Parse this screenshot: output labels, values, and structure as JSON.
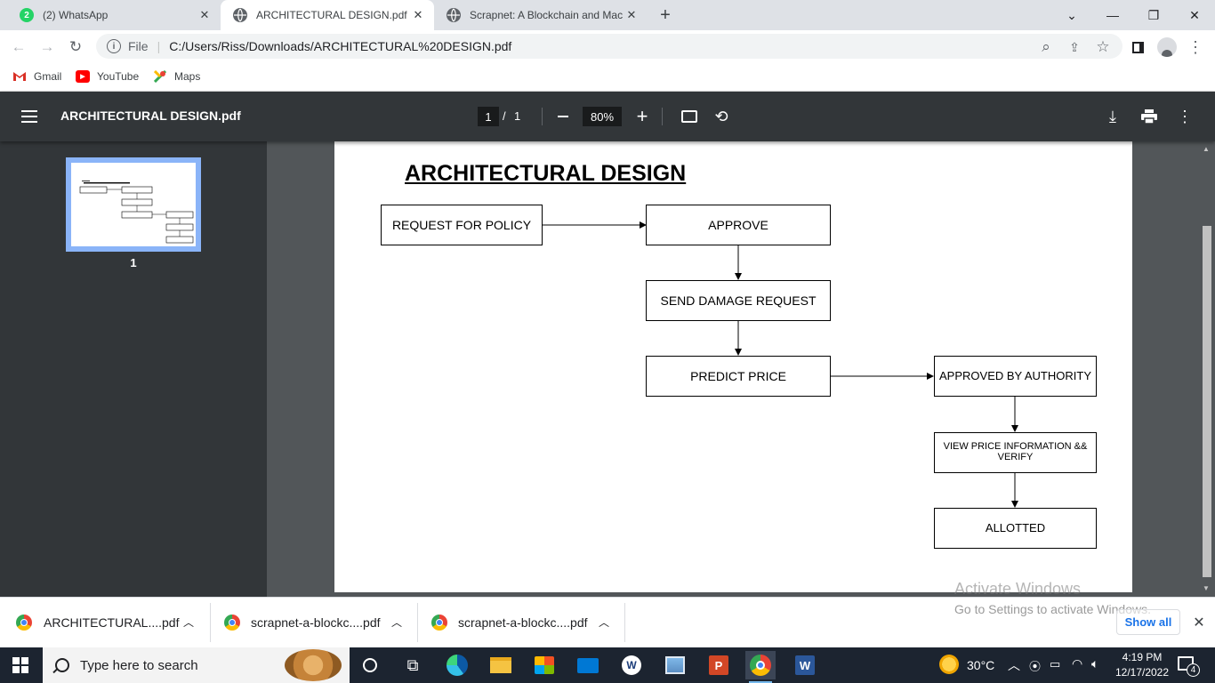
{
  "browser": {
    "tabs": [
      {
        "title": "(2) WhatsApp",
        "badge": "2",
        "active": false
      },
      {
        "title": "ARCHITECTURAL DESIGN.pdf",
        "active": true
      },
      {
        "title": "Scrapnet: A Blockchain and Mach",
        "active": false
      }
    ],
    "new_tab_icon": "plus-icon",
    "address": {
      "scheme_label": "File",
      "url": "C:/Users/Riss/Downloads/ARCHITECTURAL%20DESIGN.pdf"
    },
    "bookmarks": [
      {
        "label": "Gmail",
        "icon": "gmail-icon"
      },
      {
        "label": "YouTube",
        "icon": "youtube-icon"
      },
      {
        "label": "Maps",
        "icon": "maps-icon"
      }
    ]
  },
  "pdf_viewer": {
    "title": "ARCHITECTURAL DESIGN.pdf",
    "page_current": "1",
    "page_sep": "/",
    "page_total": "1",
    "zoom": "80%",
    "thumbnail_label": "1"
  },
  "document": {
    "heading": "ARCHITECTURAL DESIGN",
    "flow": {
      "request_policy": "REQUEST FOR POLICY",
      "approve": "APPROVE",
      "send_damage": "SEND DAMAGE REQUEST",
      "predict_price": "PREDICT PRICE",
      "approved_authority": "APPROVED BY AUTHORITY",
      "view_price": "VIEW PRICE INFORMATION && VERIFY",
      "allotted": "ALLOTTED"
    }
  },
  "watermark": {
    "title": "Activate Windows",
    "subtitle": "Go to Settings to activate Windows."
  },
  "downloads": {
    "items": [
      "ARCHITECTURAL....pdf",
      "scrapnet-a-blockc....pdf",
      "scrapnet-a-blockc....pdf"
    ],
    "show_all": "Show all"
  },
  "taskbar": {
    "search_placeholder": "Type here to search",
    "weather": "30°C",
    "time": "4:19 PM",
    "date": "12/17/2022",
    "notifications": "4"
  },
  "colors": {
    "tabstrip": "#dee1e6",
    "pdf_toolbar": "#323639",
    "pdf_bg": "#525659",
    "taskbar": "#1c2430",
    "accent": "#1a73e8"
  }
}
